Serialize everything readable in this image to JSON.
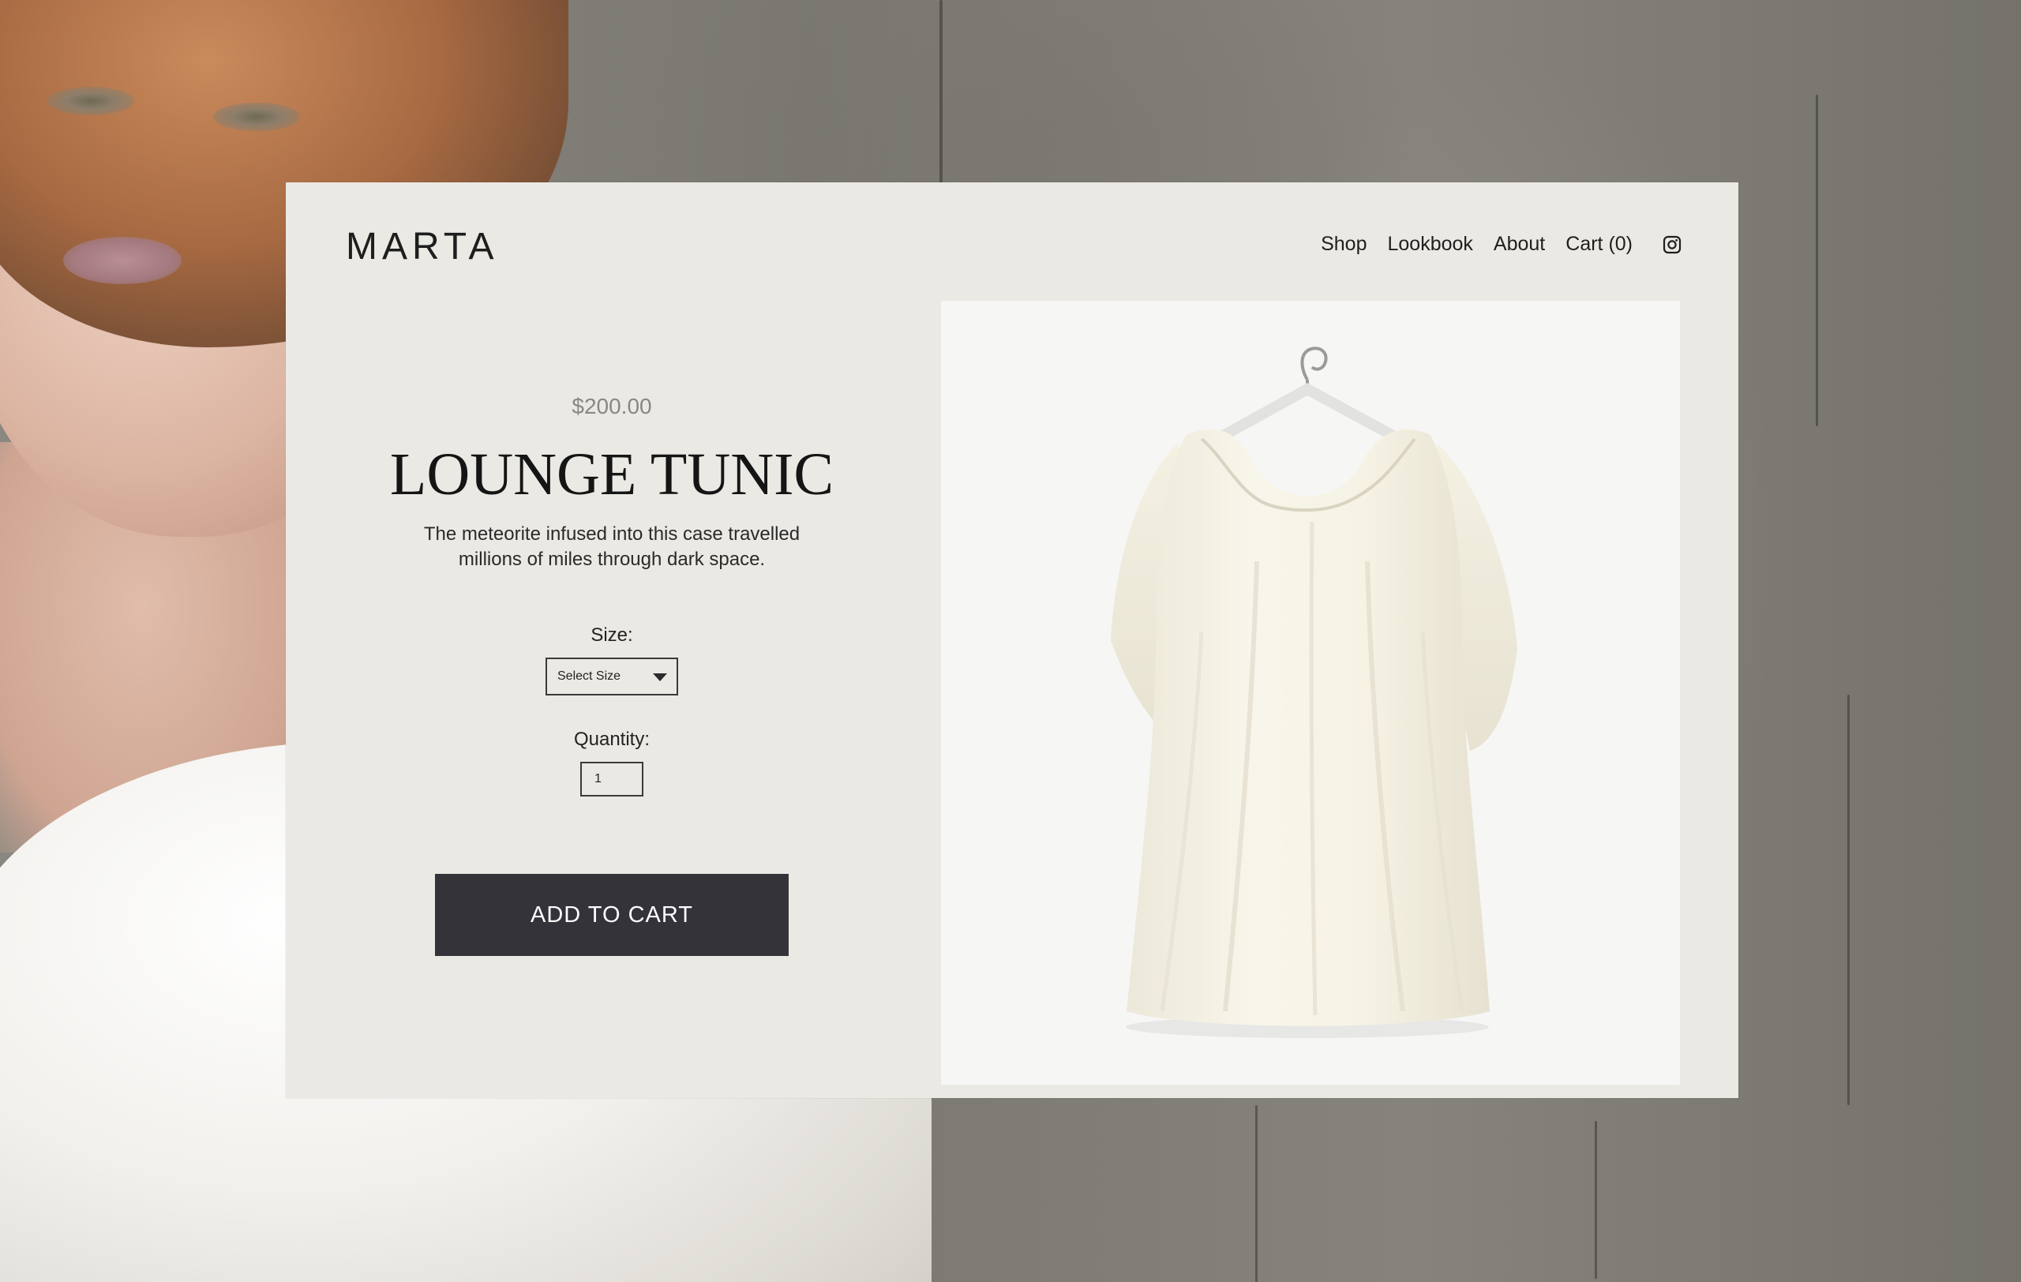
{
  "brand": {
    "logo": "MARTA"
  },
  "nav": {
    "items": [
      {
        "label": "Shop"
      },
      {
        "label": "Lookbook"
      },
      {
        "label": "About"
      },
      {
        "label": "Cart (0)"
      }
    ],
    "social_icon": "instagram-icon"
  },
  "product": {
    "price": "$200.00",
    "title": "LOUNGE TUNIC",
    "description": "The meteorite infused into this case travelled millions of miles through dark space.",
    "size": {
      "label": "Size:",
      "selected": "Select Size"
    },
    "quantity": {
      "label": "Quantity:",
      "value": "1"
    },
    "add_to_cart_label": "ADD TO CART"
  },
  "colors": {
    "card_background": "#ebe9e4",
    "button_background": "#34333a",
    "button_text": "#ffffff",
    "price_text": "#8a8783"
  }
}
